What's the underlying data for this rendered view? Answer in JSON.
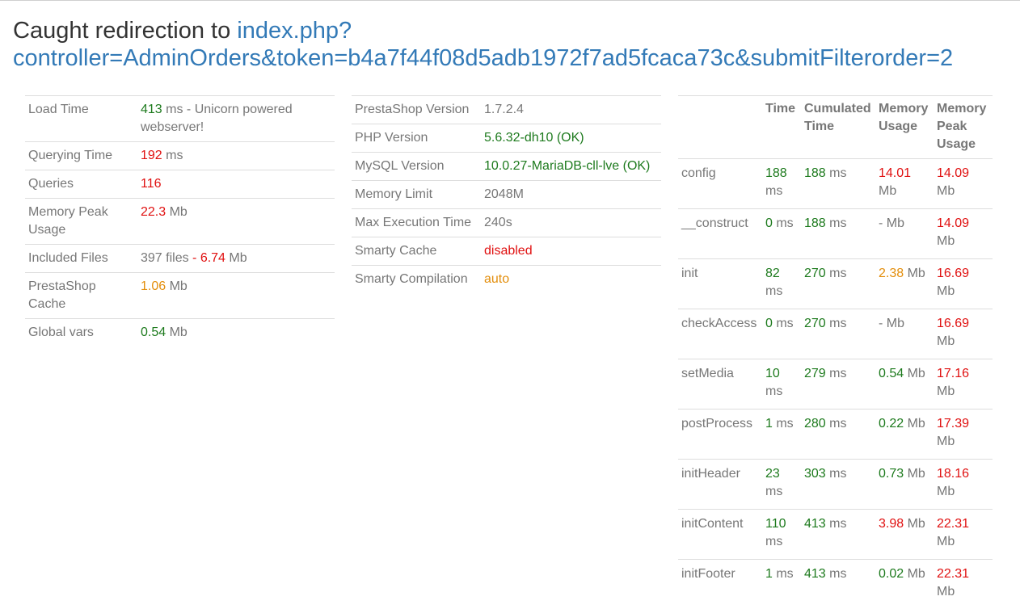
{
  "heading": {
    "prefix": "Caught redirection to ",
    "link": "index.php?controller=AdminOrders&token=b4a7f44f08d5adb1972f7ad5fcaca73c&submitFilterorder=2"
  },
  "stats": {
    "load_time": {
      "label": "Load Time",
      "value": "413",
      "rest": " ms - Unicorn powered webserver!"
    },
    "querying_time": {
      "label": "Querying Time",
      "value": "192",
      "unit": " ms"
    },
    "queries": {
      "label": "Queries",
      "value": "116"
    },
    "memory_peak": {
      "label": "Memory Peak Usage",
      "value": "22.3",
      "unit": " Mb"
    },
    "included_files": {
      "label": "Included Files",
      "files": "397 files",
      "sep": " - ",
      "size": "6.74",
      "unit": " Mb"
    },
    "ps_cache": {
      "label": "PrestaShop Cache",
      "value": "1.06",
      "unit": " Mb"
    },
    "global_vars": {
      "label": "Global vars",
      "value": "0.54",
      "unit": " Mb"
    }
  },
  "config": {
    "ps_version": {
      "label": "PrestaShop Version",
      "value": "1.7.2.4"
    },
    "php_version": {
      "label": "PHP Version",
      "value": "5.6.32-dh10 (OK)"
    },
    "mysql_version": {
      "label": "MySQL Version",
      "value": "10.0.27-MariaDB-cll-lve (OK)"
    },
    "memory_limit": {
      "label": "Memory Limit",
      "value": "2048M"
    },
    "max_exec": {
      "label": "Max Execution Time",
      "value": "240s"
    },
    "smarty_cache": {
      "label": "Smarty Cache",
      "value": "disabled"
    },
    "smarty_compile": {
      "label": "Smarty Compilation",
      "value": "auto"
    }
  },
  "timing": {
    "headers": [
      "",
      "Time",
      "Cumulated Time",
      "Memory Usage",
      "Memory Peak Usage"
    ],
    "rows": [
      {
        "name": "config",
        "time": "188",
        "time_unit": " ms",
        "cum": "188",
        "cum_unit": " ms",
        "mem": "14.01",
        "mem_unit": " Mb",
        "peak": "14.09",
        "peak_unit": " Mb"
      },
      {
        "name": "__construct",
        "time": "0",
        "time_unit": " ms",
        "cum": "188",
        "cum_unit": " ms",
        "mem": "-",
        "mem_unit": " Mb",
        "peak": "14.09",
        "peak_unit": " Mb"
      },
      {
        "name": "init",
        "time": "82",
        "time_unit": " ms",
        "cum": "270",
        "cum_unit": " ms",
        "mem": "2.38",
        "mem_unit": " Mb",
        "peak": "16.69",
        "peak_unit": " Mb"
      },
      {
        "name": "checkAccess",
        "time": "0",
        "time_unit": " ms",
        "cum": "270",
        "cum_unit": " ms",
        "mem": "-",
        "mem_unit": " Mb",
        "peak": "16.69",
        "peak_unit": " Mb"
      },
      {
        "name": "setMedia",
        "time": "10",
        "time_unit": " ms",
        "cum": "279",
        "cum_unit": " ms",
        "mem": "0.54",
        "mem_unit": " Mb",
        "peak": "17.16",
        "peak_unit": " Mb"
      },
      {
        "name": "postProcess",
        "time": "1",
        "time_unit": " ms",
        "cum": "280",
        "cum_unit": " ms",
        "mem": "0.22",
        "mem_unit": " Mb",
        "peak": "17.39",
        "peak_unit": " Mb"
      },
      {
        "name": "initHeader",
        "time": "23",
        "time_unit": " ms",
        "cum": "303",
        "cum_unit": " ms",
        "mem": "0.73",
        "mem_unit": " Mb",
        "peak": "18.16",
        "peak_unit": " Mb"
      },
      {
        "name": "initContent",
        "time": "110",
        "time_unit": " ms",
        "cum": "413",
        "cum_unit": " ms",
        "mem": "3.98",
        "mem_unit": " Mb",
        "peak": "22.31",
        "peak_unit": " Mb"
      },
      {
        "name": "initFooter",
        "time": "1",
        "time_unit": " ms",
        "cum": "413",
        "cum_unit": " ms",
        "mem": "0.02",
        "mem_unit": " Mb",
        "peak": "22.31",
        "peak_unit": " Mb"
      }
    ]
  },
  "colors": {
    "good": "#1d7a1d",
    "bad": "#e01010",
    "warn": "#e38e0c",
    "link": "#337ab7"
  }
}
